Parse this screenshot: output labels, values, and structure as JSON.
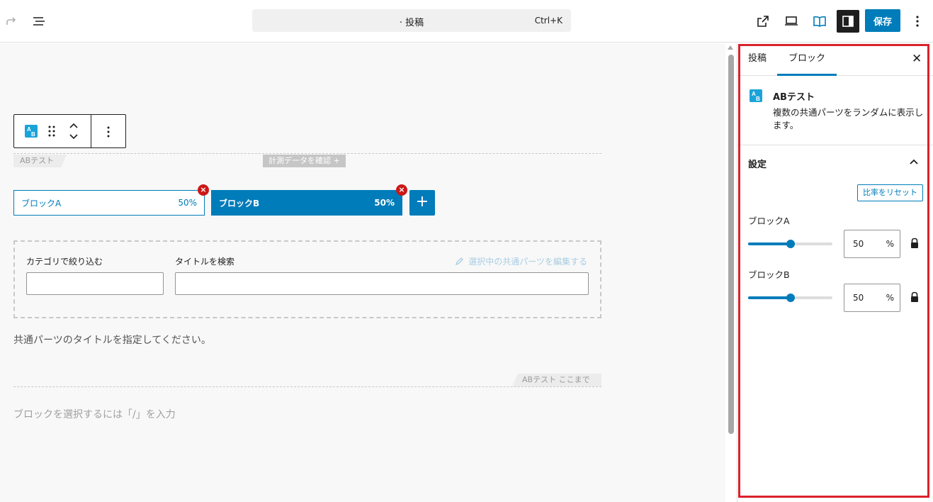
{
  "topbar": {
    "command_title": "· 投稿",
    "command_shortcut": "Ctrl+K",
    "save_label": "保存",
    "icons": [
      "redo-icon",
      "list-view-icon",
      "external-link-icon",
      "device-preview-icon",
      "book-icon",
      "sidebar-toggle-icon",
      "more-options-icon"
    ]
  },
  "editor": {
    "ab_tag": "ABテスト",
    "measure_tag": "計測データを確認 +",
    "patterns": [
      {
        "label": "ブロックA",
        "percent": "50%"
      },
      {
        "label": "ブロックB",
        "percent": "50%"
      }
    ],
    "add_pattern_label": "+",
    "filter": {
      "category_label": "カテゴリで絞り込む",
      "title_label": "タイトルを検索",
      "edit_link": "選択中の共通パーツを編集する",
      "category_value": "",
      "title_value": ""
    },
    "hint": "共通パーツのタイトルを指定してください。",
    "ab_end_tag": "ABテスト ここまで",
    "block_placeholder": "ブロックを選択するには「/」を入力"
  },
  "sidebar": {
    "tabs": [
      "投稿",
      "ブロック"
    ],
    "active_tab": "ブロック",
    "block": {
      "title": "ABテスト",
      "description": "複数の共通パーツをランダムに表示します。"
    },
    "panel": {
      "title": "設定",
      "reset_label": "比率をリセット",
      "ratios": [
        {
          "label": "ブロックA",
          "value": "50",
          "unit": "%",
          "fraction": 0.5
        },
        {
          "label": "ブロックB",
          "value": "50",
          "unit": "%",
          "fraction": 0.5
        }
      ]
    }
  },
  "colors": {
    "accent": "#007cba",
    "highlight": "#d9222a",
    "remove": "#cc1818"
  }
}
